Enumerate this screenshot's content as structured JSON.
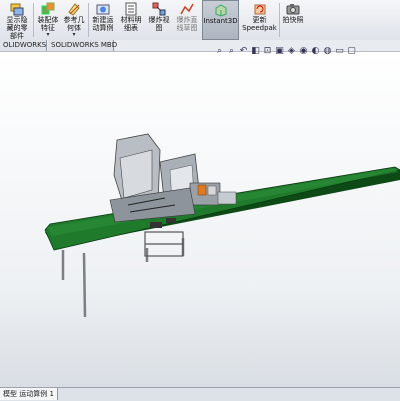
{
  "ribbon": {
    "buttons": [
      {
        "label": "显示隐\n藏的零\n部件",
        "icon": "show-hidden-components-icon",
        "dropdown": false
      },
      {
        "label": "装配体\n特征",
        "icon": "assembly-features-icon",
        "dropdown": true
      },
      {
        "label": "参考几\n何体",
        "icon": "reference-geometry-icon",
        "dropdown": true
      },
      {
        "label": "新建运\n动算例",
        "icon": "new-motion-study-icon",
        "dropdown": false
      },
      {
        "label": "材料明\n细表",
        "icon": "bill-of-materials-icon",
        "dropdown": false
      },
      {
        "label": "爆炸视\n图",
        "icon": "exploded-view-icon",
        "dropdown": false
      },
      {
        "label": "爆炸直\n线草图",
        "icon": "explode-line-sketch-icon",
        "dropdown": false
      },
      {
        "label": "Instant3D",
        "icon": "instant3d-icon",
        "dropdown": false
      },
      {
        "label": "更新\nSpeedpak",
        "icon": "update-speedpak-icon",
        "dropdown": false
      },
      {
        "label": "拍快照",
        "icon": "take-snapshot-icon",
        "dropdown": false
      }
    ],
    "dropdown_glyph": "▾"
  },
  "command_tabs": [
    "OLIDWORKS 插件",
    "SOLIDWORKS MBD"
  ],
  "view_toolbar": [
    "zoom-to-fit-icon",
    "zoom-to-area-icon",
    "previous-view-icon",
    "section-view-icon",
    "dynamic-annotation-icon",
    "view-orientation-icon",
    "display-style-icon",
    "hide-show-items-icon",
    "edit-appearance-icon",
    "apply-scene-icon",
    "view-settings-icon",
    "monitor-icon"
  ],
  "status_bar": {
    "sheet_tab": "模型  运动算例 1"
  },
  "colors": {
    "conveyor_top": "#1f7a2c",
    "conveyor_side": "#0d4a16",
    "machine_gray": "#9aa0a6",
    "machine_orange": "#e07a1f"
  }
}
